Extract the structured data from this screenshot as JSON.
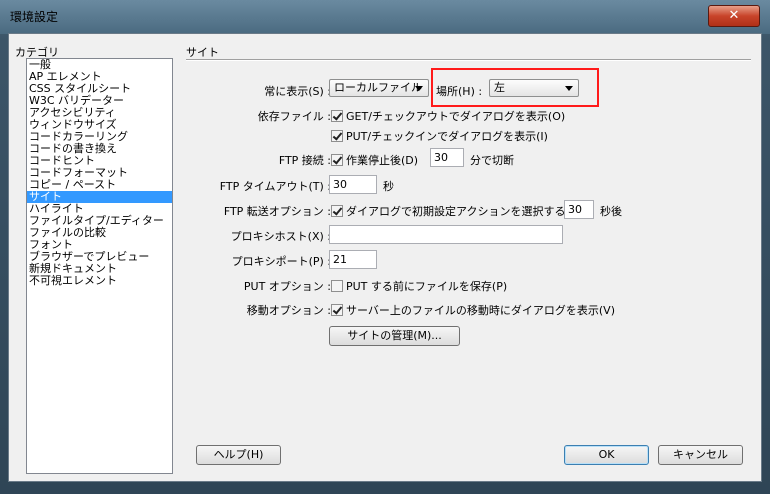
{
  "window": {
    "title": "環境設定",
    "close": "✕"
  },
  "categories": {
    "label": "カテゴリ",
    "items": [
      "一般",
      "AP エレメント",
      "CSS スタイルシート",
      "W3C バリデーター",
      "アクセシビリティ",
      "ウィンドウサイズ",
      "コードカラーリング",
      "コードの書き換え",
      "コードヒント",
      "コードフォーマット",
      "コピー / ペースト",
      "サイト",
      "ハイライト",
      "ファイルタイプ/エディター",
      "ファイルの比較",
      "フォント",
      "ブラウザーでプレビュー",
      "新規ドキュメント",
      "不可視エレメント"
    ],
    "selected": "サイト"
  },
  "section": {
    "title": "サイト"
  },
  "settings": {
    "always_show": {
      "label": "常に表示(S) :",
      "value": "ローカルファイル"
    },
    "location": {
      "label": "場所(H) :",
      "value": "左"
    },
    "dependent_files": {
      "label": "依存ファイル :",
      "opt1": "GET/チェックアウトでダイアログを表示(O)",
      "opt2": "PUT/チェックインでダイアログを表示(I)"
    },
    "ftp_connection": {
      "label": "FTP 接続 :",
      "opt": "作業停止後(D)",
      "value": "30",
      "unit": "分で切断"
    },
    "ftp_timeout": {
      "label": "FTP タイムアウト(T) :",
      "value": "30",
      "unit": "秒"
    },
    "ftp_transfer": {
      "label": "FTP 転送オプション :",
      "opt": "ダイアログで初期設定アクションを選択する(A)",
      "value": "30",
      "unit": "秒後"
    },
    "proxy_host": {
      "label": "プロキシホスト(X) :",
      "value": ""
    },
    "proxy_port": {
      "label": "プロキシポート(P) :",
      "value": "21"
    },
    "put_options": {
      "label": "PUT オプション :",
      "opt": "PUT する前にファイルを保存(P)"
    },
    "move_options": {
      "label": "移動オプション :",
      "opt": "サーバー上のファイルの移動時にダイアログを表示(V)"
    },
    "manage_sites": "サイトの管理(M)..."
  },
  "buttons": {
    "help": "ヘルプ(H)",
    "ok": "OK",
    "cancel": "キャンセル"
  }
}
